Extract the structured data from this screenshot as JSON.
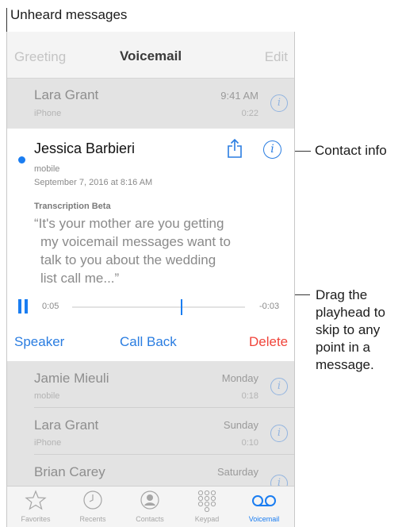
{
  "annotations": {
    "unheard": "Unheard messages",
    "contact_info": "Contact info",
    "drag_playhead": [
      "Drag the",
      "playhead to",
      "skip to any",
      "point in a",
      "message."
    ]
  },
  "nav": {
    "left": "Greeting",
    "title": "Voicemail",
    "right": "Edit"
  },
  "voicemails_top": [
    {
      "name": "Lara Grant",
      "label": "iPhone",
      "time": "9:41 AM",
      "duration": "0:22"
    }
  ],
  "expanded": {
    "name": "Jessica Barbieri",
    "label": "mobile",
    "date": "September 7, 2016 at 8:16 AM",
    "transcription_label": "Transcription Beta",
    "transcription": [
      "“It's your mother are you getting",
      "my voicemail messages want to",
      "talk to you about the wedding",
      "list call me...”"
    ],
    "elapsed": "0:05",
    "remaining": "-0:03",
    "progress": 0.63,
    "actions": {
      "speaker": "Speaker",
      "call_back": "Call Back",
      "delete": "Delete"
    }
  },
  "voicemails_bottom": [
    {
      "name": "Jamie Mieuli",
      "label": "mobile",
      "time": "Monday",
      "duration": "0:18"
    },
    {
      "name": "Lara Grant",
      "label": "iPhone",
      "time": "Sunday",
      "duration": "0:10"
    },
    {
      "name": "Brian Carey",
      "label": "",
      "time": "Saturday",
      "duration": ""
    }
  ],
  "tabs": [
    {
      "label": "Favorites",
      "icon": "star-icon"
    },
    {
      "label": "Recents",
      "icon": "clock-icon"
    },
    {
      "label": "Contacts",
      "icon": "person-icon"
    },
    {
      "label": "Keypad",
      "icon": "keypad-icon"
    },
    {
      "label": "Voicemail",
      "icon": "voicemail-icon",
      "active": true
    }
  ],
  "colors": {
    "accent": "#1a7df1",
    "delete": "#f0443a",
    "grey_row": "#e3e3e3"
  }
}
